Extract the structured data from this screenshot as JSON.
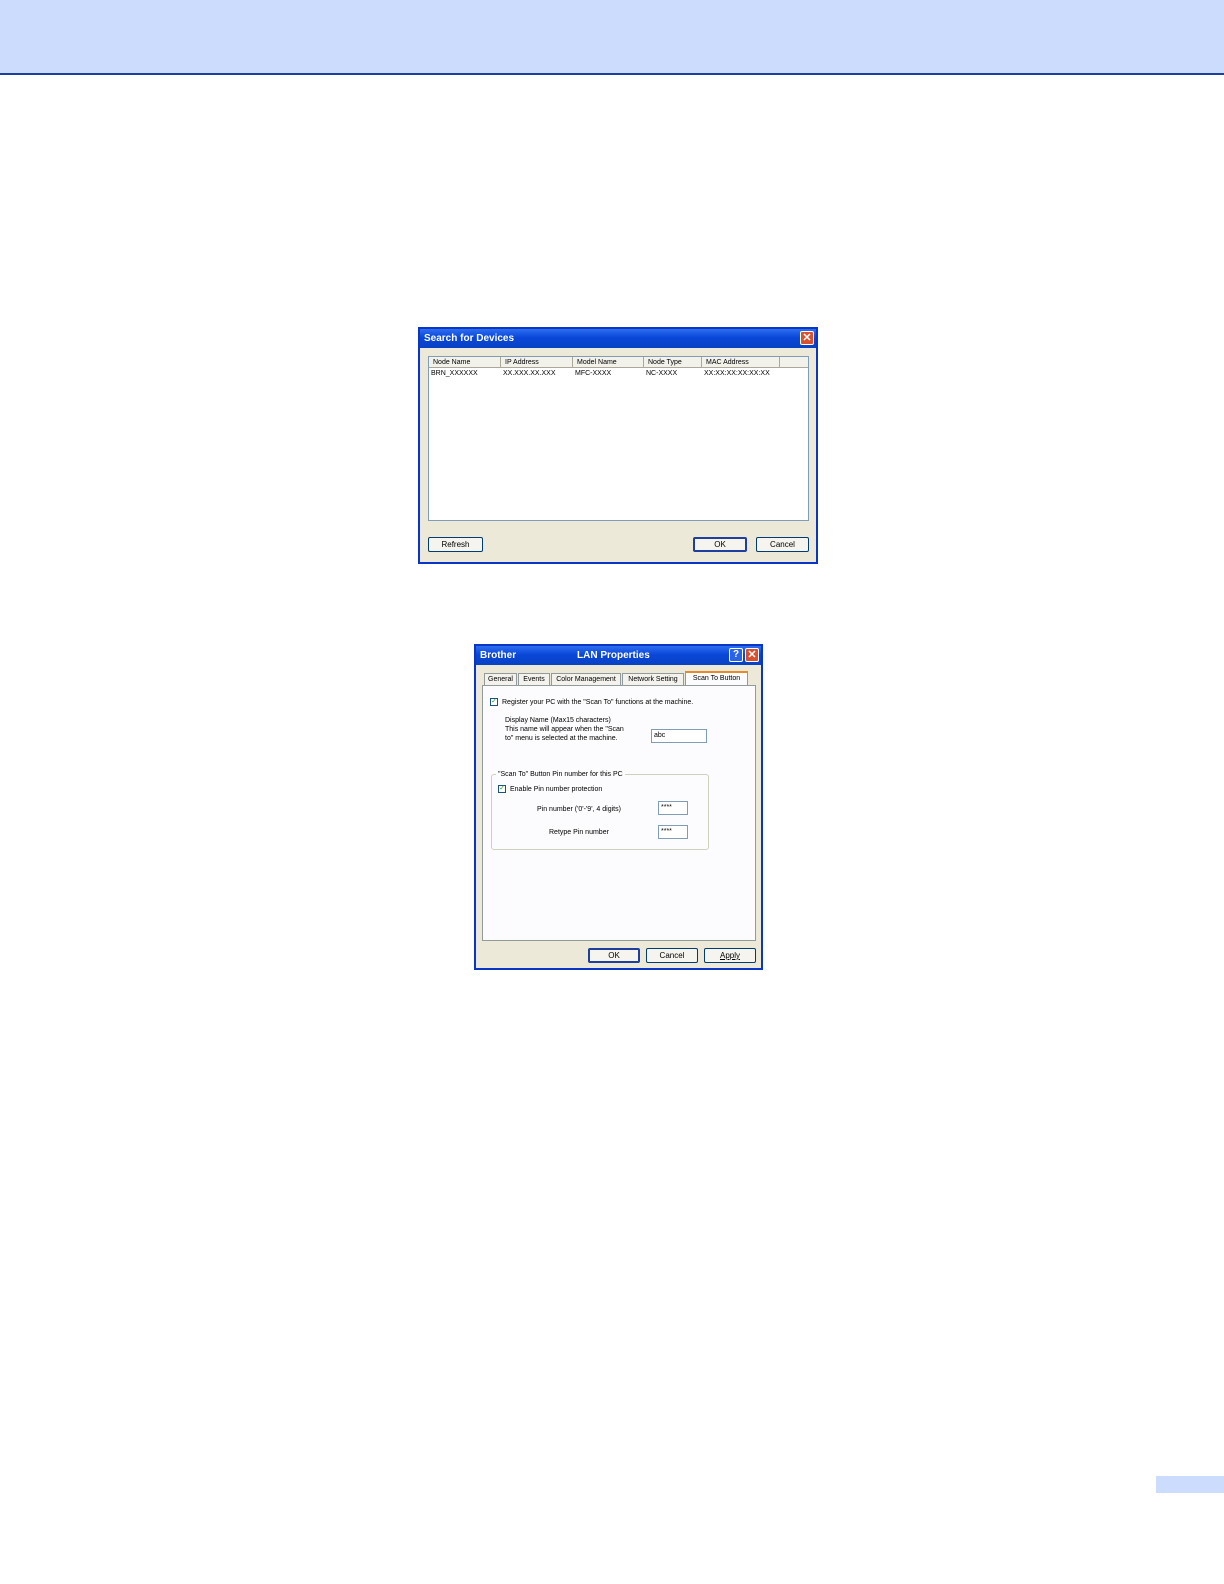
{
  "search_dialog": {
    "title": "Search for Devices",
    "columns": [
      "Node Name",
      "IP Address",
      "Model Name",
      "Node Type",
      "MAC Address"
    ],
    "rows": [
      [
        "BRN_XXXXXX",
        "XX.XXX.XX.XXX",
        "MFC-XXXX",
        "NC-XXXX",
        "XX:XX:XX:XX:XX:XX"
      ]
    ],
    "refresh_label": "Refresh",
    "ok_label": "OK",
    "cancel_label": "Cancel"
  },
  "lan_dialog": {
    "title_left": "Brother",
    "title_right": "LAN Properties",
    "help_label": "?",
    "tabs": [
      "General",
      "Events",
      "Color Management",
      "Network Setting",
      "Scan To Button"
    ],
    "register_label": "Register your PC with the \"Scan To\" functions at the machine.",
    "display_name_line1": "Display Name (Max15 characters)",
    "display_name_line2": "This name will appear when the \"Scan",
    "display_name_line3": "to\" menu is selected at the machine.",
    "display_name_value": "abc",
    "group_label": "\"Scan To\" Button Pin number for this PC",
    "enable_pin_label": "Enable Pin number protection",
    "pin_label": "Pin number ('0'-'9', 4 digits)",
    "pin_value": "****",
    "retype_label": "Retype Pin number",
    "retype_value": "****",
    "ok_label": "OK",
    "cancel_label": "Cancel",
    "apply_label": "Apply"
  }
}
